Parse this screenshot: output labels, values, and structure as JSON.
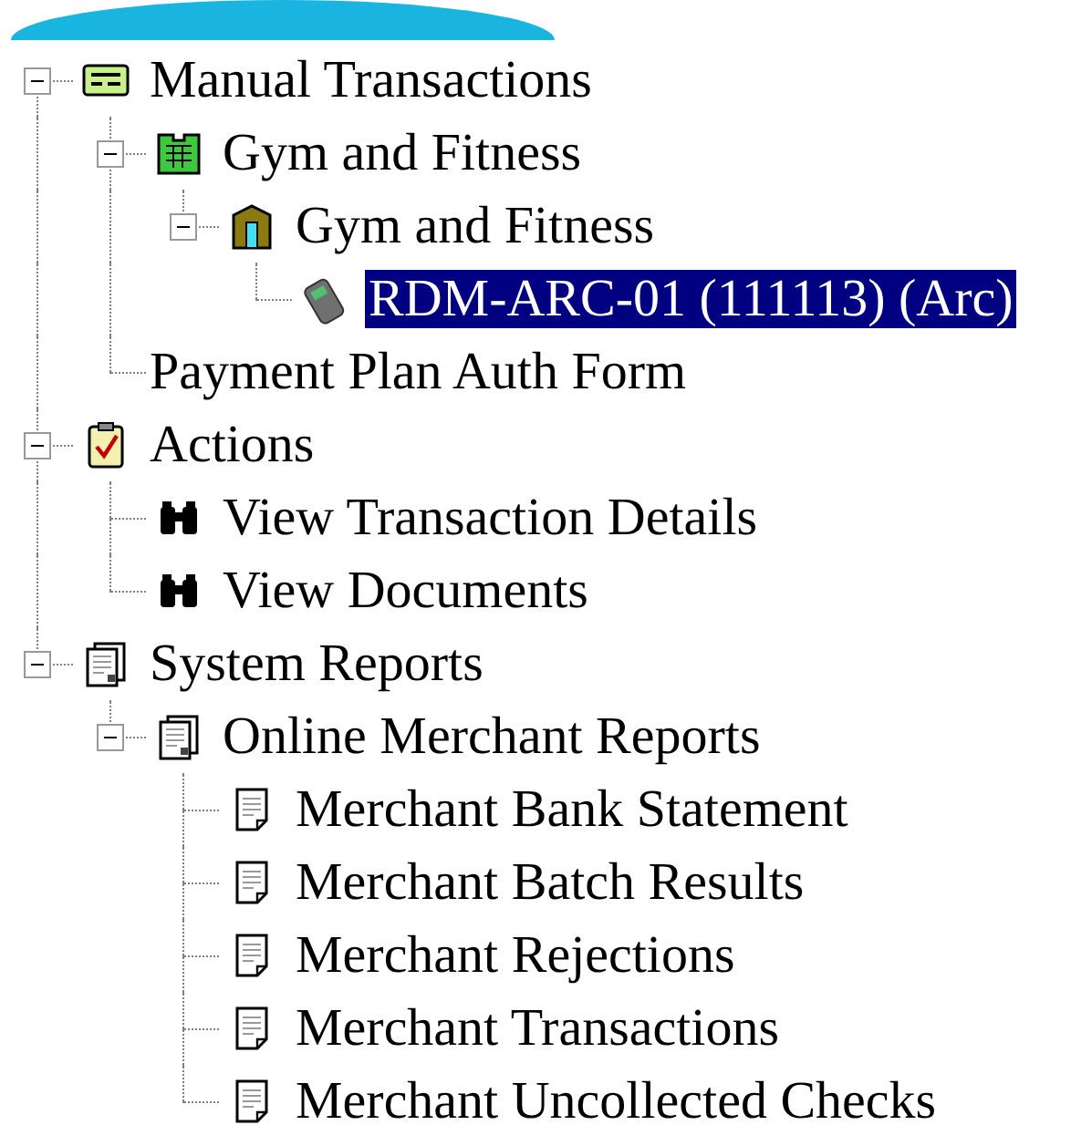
{
  "tree": [
    {
      "label": "Manual Transactions",
      "kind": "card",
      "expanded": true,
      "selected": false,
      "children": [
        {
          "label": "Gym and Fitness",
          "kind": "building",
          "expanded": true,
          "selected": false,
          "children": [
            {
              "label": "Gym and Fitness",
              "kind": "house",
              "expanded": true,
              "selected": false,
              "children": [
                {
                  "label": "RDM-ARC-01 (111113) (Arc)",
                  "kind": "terminal",
                  "selected": true
                }
              ]
            }
          ]
        },
        {
          "label": "Payment Plan Auth Form",
          "kind": "plain",
          "selected": false
        }
      ]
    },
    {
      "label": "Actions",
      "kind": "clipboard",
      "expanded": true,
      "selected": false,
      "children": [
        {
          "label": "View Transaction Details",
          "kind": "binoculars",
          "selected": false
        },
        {
          "label": "View Documents",
          "kind": "binoculars",
          "selected": false
        }
      ]
    },
    {
      "label": "System Reports",
      "kind": "reports",
      "expanded": true,
      "selected": false,
      "children": [
        {
          "label": "Online Merchant Reports",
          "kind": "reports",
          "expanded": true,
          "selected": false,
          "children": [
            {
              "label": "Merchant Bank Statement",
              "kind": "page",
              "selected": false
            },
            {
              "label": "Merchant Batch Results",
              "kind": "page",
              "selected": false
            },
            {
              "label": "Merchant Rejections",
              "kind": "page",
              "selected": false
            },
            {
              "label": "Merchant Transactions",
              "kind": "page",
              "selected": false
            },
            {
              "label": "Merchant Uncollected Checks",
              "kind": "page",
              "selected": false
            }
          ]
        }
      ]
    }
  ]
}
